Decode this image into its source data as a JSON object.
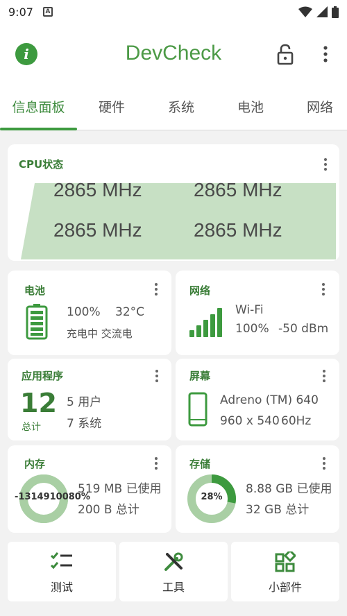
{
  "status_bar": {
    "time": "9:07",
    "notification_icon": "A"
  },
  "app_bar": {
    "title": "DevCheck",
    "info_icon": "i"
  },
  "tabs": [
    {
      "label": "信息面板",
      "active": true
    },
    {
      "label": "硬件"
    },
    {
      "label": "系统"
    },
    {
      "label": "电池"
    },
    {
      "label": "网络"
    }
  ],
  "cpu": {
    "title": "CPU状态",
    "cores": [
      "2865 MHz",
      "2865 MHz",
      "2865 MHz",
      "2865 MHz"
    ]
  },
  "battery": {
    "title": "电池",
    "level": "100%",
    "temp": "32°C",
    "status": "充电中 交流电"
  },
  "network": {
    "title": "网络",
    "type": "Wi-Fi",
    "strength": "100%",
    "signal": "-50 dBm"
  },
  "apps": {
    "title": "应用程序",
    "total": "12",
    "total_label": "总计",
    "user": "5 用户",
    "system": "7 系统"
  },
  "screen": {
    "title": "屏幕",
    "gpu": "Adreno (TM) 640",
    "resolution": "960 x 540",
    "refresh": "60Hz"
  },
  "memory": {
    "title": "内存",
    "percent": "-1314910080%",
    "used": "519 MB 已使用",
    "total": "200 B 总计",
    "fill_fraction": 1.0
  },
  "storage": {
    "title": "存储",
    "percent": "28%",
    "used": "8.88 GB 已使用",
    "total": "32 GB 总计",
    "fill_fraction": 0.28
  },
  "tools": [
    {
      "label": "测试",
      "icon": "checklist-icon"
    },
    {
      "label": "工具",
      "icon": "tools-icon"
    },
    {
      "label": "小部件",
      "icon": "widgets-icon"
    }
  ],
  "colors": {
    "accent": "#3d9a3f",
    "accent_light": "#a9cfa4",
    "cpu_fill": "#c7e0c4"
  }
}
